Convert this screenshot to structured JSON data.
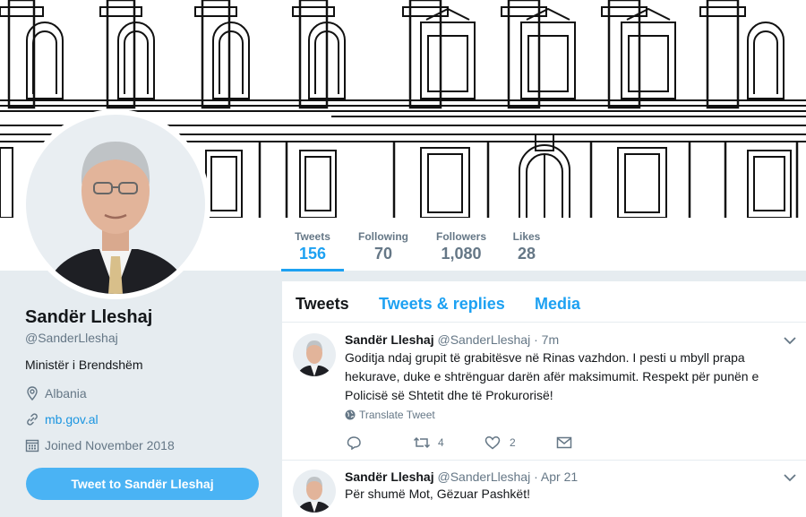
{
  "profile": {
    "name": "Sandër Lleshaj",
    "handle": "@SanderLleshaj",
    "bio": "Ministër i Brendshëm",
    "location": "Albania",
    "website": "mb.gov.al",
    "joined": "Joined November 2018",
    "tweet_to_label": "Tweet to Sandër Lleshaj"
  },
  "stats": [
    {
      "label": "Tweets",
      "value": "156"
    },
    {
      "label": "Following",
      "value": "70"
    },
    {
      "label": "Followers",
      "value": "1,080"
    },
    {
      "label": "Likes",
      "value": "28"
    }
  ],
  "tabs": [
    "Tweets",
    "Tweets & replies",
    "Media"
  ],
  "tweets": [
    {
      "name": "Sandër Lleshaj",
      "handle": "@SanderLleshaj",
      "dot": "·",
      "time": "7m",
      "text": "Goditja ndaj grupit të grabitësve në Rinas vazhdon. I pesti u mbyll prapa hekurave, duke e shtrënguar darën afër maksimumit. Respekt për punën e Policisë së Shtetit dhe të Prokurorisë!",
      "translate": "Translate Tweet",
      "retweets": "4",
      "likes": "2"
    },
    {
      "name": "Sandër Lleshaj",
      "handle": "@SanderLleshaj",
      "dot": "·",
      "time": "Apr 21",
      "text": "Për shumë Mot, Gëzuar Pashkët!"
    }
  ],
  "colors": {
    "accent": "#1da1f2",
    "button": "#4ab3f4",
    "muted": "#657786",
    "background": "#e6ecf0"
  },
  "icons": [
    "location-icon",
    "link-icon",
    "calendar-icon",
    "globe-icon",
    "reply-icon",
    "retweet-icon",
    "like-icon",
    "message-icon",
    "chevron-down-icon"
  ]
}
